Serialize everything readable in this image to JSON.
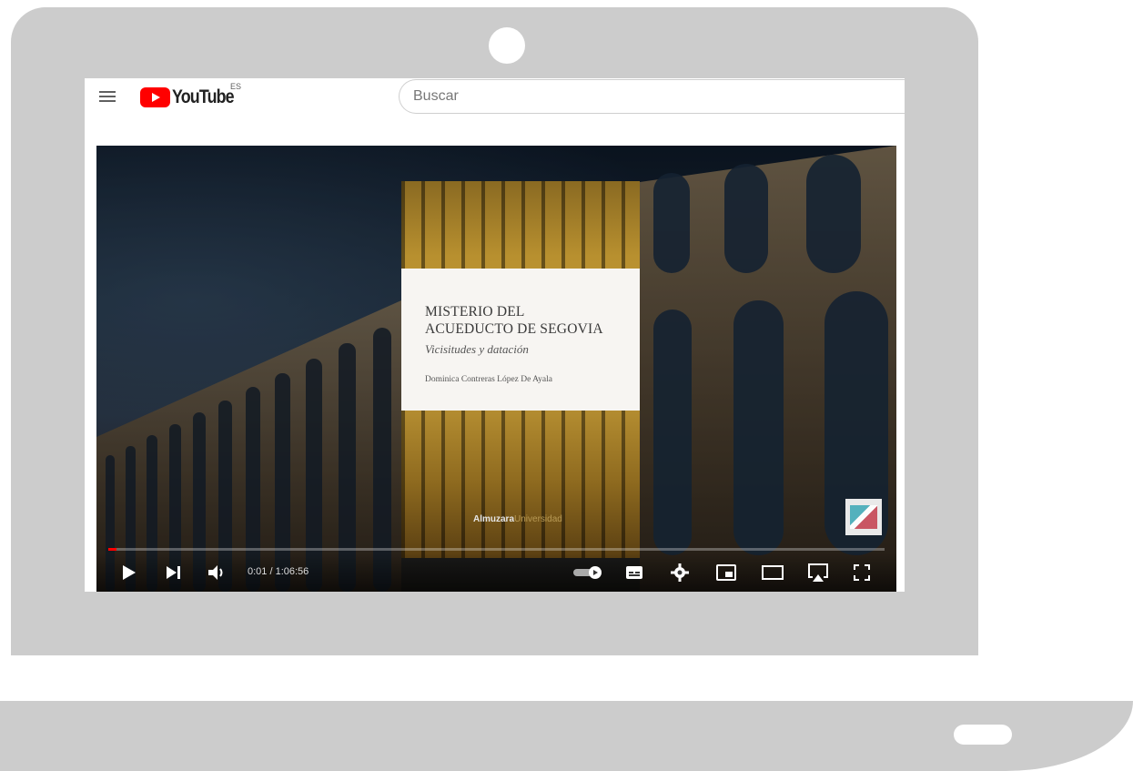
{
  "youtube": {
    "logo_text": "YouTube",
    "country_code": "ES",
    "search_placeholder": "Buscar"
  },
  "video": {
    "book": {
      "title_line1": "MISTERIO DEL",
      "title_line2": "ACUEDUCTO DE SEGOVIA",
      "subtitle": "Vicisitudes y datación",
      "author": "Dominica Contreras López De Ayala",
      "publisher_bold": "Almuzara",
      "publisher_light": "Universidad"
    },
    "progress": 0.003,
    "time_display": "0:01 / 1:06:56"
  },
  "icons": [
    "menu-icon",
    "youtube-logo-icon",
    "play-icon",
    "next-icon",
    "volume-icon",
    "autoplay-toggle-icon",
    "subtitles-icon",
    "settings-icon",
    "miniplayer-icon",
    "theater-mode-icon",
    "airplay-icon",
    "fullscreen-icon",
    "camera-icon"
  ],
  "colors": {
    "frame": "#cccccc",
    "youtube_red": "#ff0000"
  }
}
